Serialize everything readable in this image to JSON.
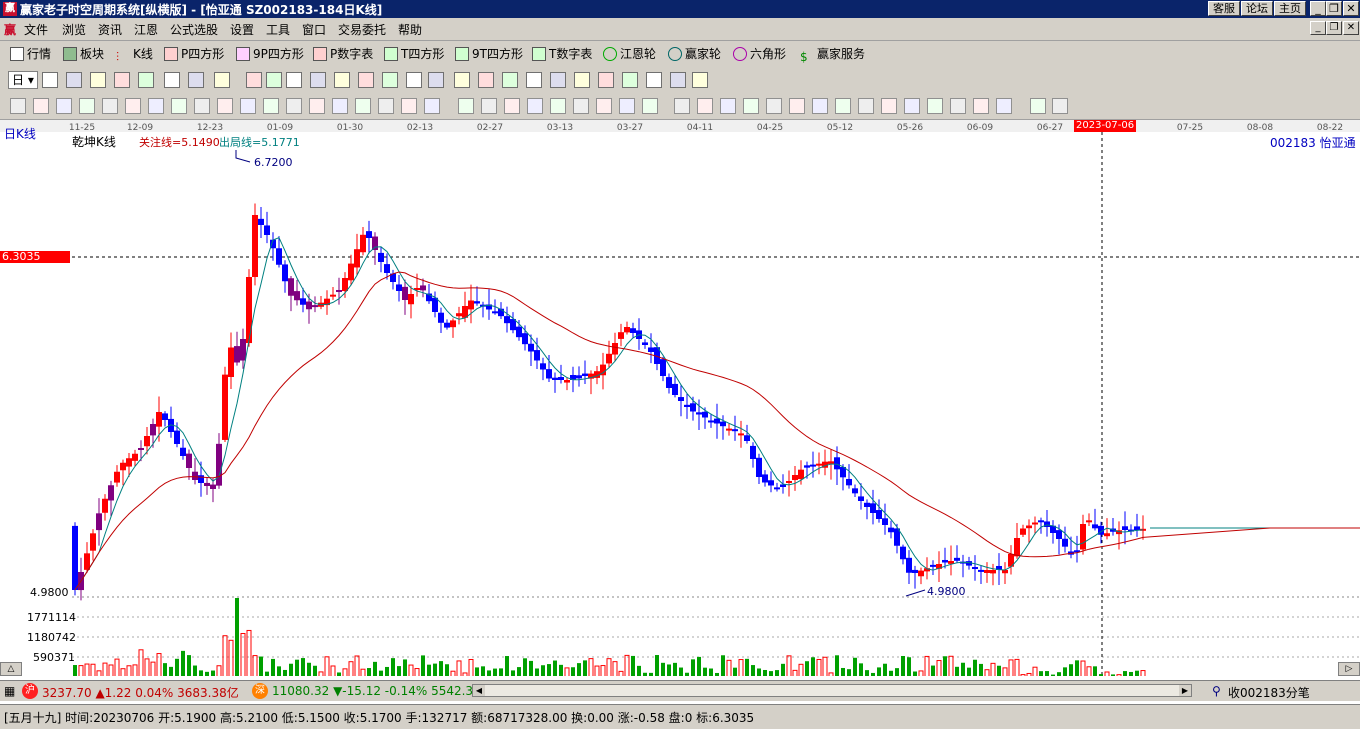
{
  "window": {
    "title": "赢家老子时空周期系统[纵横版] - [怡亚通   SZ002183-184日K线]",
    "app_icon": "赢",
    "top_links": [
      "客服",
      "论坛",
      "主页"
    ]
  },
  "menu": [
    "文件",
    "浏览",
    "资讯",
    "江恩",
    "公式选股",
    "设置",
    "工具",
    "窗口",
    "交易委托",
    "帮助"
  ],
  "toolbar1": [
    "行情",
    "板块",
    "K线",
    "P四方形",
    "9P四方形",
    "P数字表",
    "T四方形",
    "9T四方形",
    "T数字表",
    "江恩轮",
    "赢家轮",
    "六角形",
    "赢家服务"
  ],
  "toolbar2": {
    "period": "日"
  },
  "chart": {
    "label": "日K线",
    "name": "乾坤K线",
    "focus_line": "关注线=5.1490",
    "exit_line": "出局线=5.1771",
    "stock": "002183  怡亚通",
    "high_label": "6.7200",
    "low_label": "4.9800",
    "low_axis": "4.9800",
    "price_marker": "6.3035",
    "cursor_date": "2023-07-06",
    "date_ticks": [
      "11-25",
      "12-09",
      "12-23",
      "01-09",
      "01-30",
      "02-13",
      "02-27",
      "03-13",
      "03-27",
      "04-11",
      "04-25",
      "05-12",
      "05-26",
      "06-09",
      "06-27",
      "07-25",
      "08-08",
      "08-22"
    ],
    "volume_ticks": [
      "1771114",
      "1180742",
      "590371"
    ]
  },
  "status1": {
    "sh_icon": "沪",
    "sh": "3237.70 ▲1.22 0.04% 3683.38亿",
    "sz_icon": "深",
    "sz": "11080.32 ▼-15.12 -0.14% 5542.3",
    "right": "收002183分笔"
  },
  "status2": {
    "text": "[五月十九] 时间:20230706 开:5.1900 高:5.2100 低:5.1500 收:5.1700 手:132717 额:68717328.00 换:0.00 涨:-0.58 盘:0 标:6.3035"
  },
  "chart_data": {
    "type": "candlestick",
    "x_ticks": [
      "11-25",
      "12-09",
      "12-23",
      "01-09",
      "01-30",
      "02-13",
      "02-27",
      "03-13",
      "03-27",
      "04-11",
      "04-25",
      "05-12",
      "05-26",
      "06-09",
      "06-27",
      "07-25",
      "08-08",
      "08-22"
    ],
    "labels": {
      "high": 6.72,
      "low": 4.98,
      "marker": 6.3035
    },
    "ylim": [
      4.9,
      6.9
    ]
  },
  "colors": {
    "up": "#ff0000",
    "down": "#0000ff",
    "doji": "#800080",
    "vol_up": "#ff0000",
    "vol_down": "#00a000",
    "ma_short": "#008080",
    "ma_long": "#c00000"
  }
}
